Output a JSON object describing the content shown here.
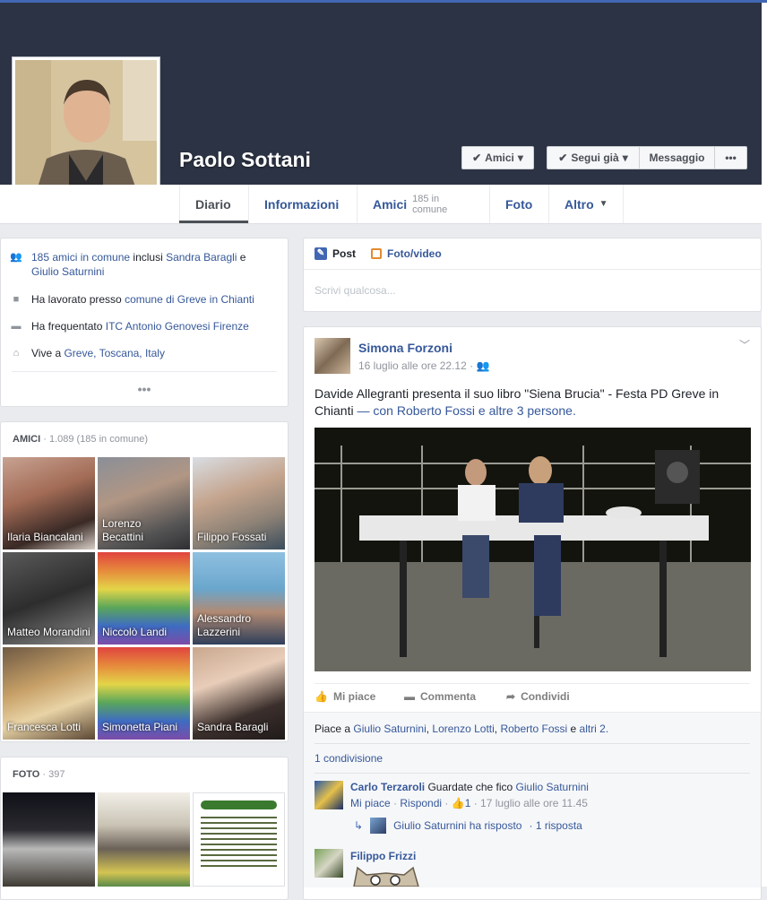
{
  "profile": {
    "name": "Paolo Sottani",
    "buttons": {
      "friends": "Amici",
      "follow": "Segui già",
      "message": "Messaggio",
      "more": "•••"
    }
  },
  "tabs": [
    {
      "label": "Diario",
      "extra": ""
    },
    {
      "label": "Informazioni",
      "extra": ""
    },
    {
      "label": "Amici",
      "extra": "185 in comune"
    },
    {
      "label": "Foto",
      "extra": ""
    },
    {
      "label": "Altro",
      "extra": ""
    }
  ],
  "intro": {
    "mutual": {
      "link": "185 amici in comune",
      "text1": " inclusi ",
      "name1": "Sandra Baragli",
      "text2": " e ",
      "name2": "Giulio Saturnini"
    },
    "work": {
      "prefix": "Ha lavorato presso ",
      "link": "comune di Greve in Chianti"
    },
    "school": {
      "prefix": "Ha frequentato ",
      "link": "ITC Antonio Genovesi Firenze"
    },
    "lives": {
      "prefix": "Vive a ",
      "link": "Greve, Toscana, Italy"
    },
    "more": "•••"
  },
  "friends_section": {
    "title": "AMICI",
    "count": " · 1.089 (185 in comune)",
    "friends": [
      "Ilaria Biancalani",
      "Lorenzo\nBecattini",
      "Filippo Fossati",
      "Matteo Morandini",
      "Niccolò Landi",
      "Alessandro\nLazzerini",
      "Francesca Lotti",
      "Simonetta Piani",
      "Sandra Baragli"
    ]
  },
  "photos_section": {
    "title": "FOTO",
    "count": " · 397"
  },
  "composer": {
    "tab_post": "Post",
    "tab_photo": "Foto/video",
    "placeholder": "Scrivi qualcosa..."
  },
  "post": {
    "author": "Simona Forzoni",
    "time": "16 luglio alle ore 22.12 ·",
    "text": "Davide Allegranti presenta il suo libro \"Siena Brucia\" - Festa PD Greve in Chianti",
    "with_prefix": " — con ",
    "with_name": "Roberto Fossi",
    "with_and": " e ",
    "with_others": "altre 3 persone.",
    "actions": {
      "like": "Mi piace",
      "comment": "Commenta",
      "share": "Condividi"
    },
    "likes": {
      "prefix": "Piace a ",
      "n1": "Giulio Saturnini",
      "c1": ", ",
      "n2": "Lorenzo Lotti",
      "c2": ", ",
      "n3": "Roberto Fossi",
      "c3": " e ",
      "others": "altri 2."
    },
    "shares": "1 condivisione",
    "comments": [
      {
        "author": "Carlo Terzaroli",
        "text": " Guardate che fico ",
        "mention": "Giulio Saturnini",
        "like": "Mi piace",
        "reply": "Rispondi",
        "like_count": "1",
        "time": "17 luglio alle ore 11.45",
        "reply_summary": "Giulio Saturnini ha risposto",
        "reply_count": "· 1 risposta"
      },
      {
        "author": "Filippo Frizzi"
      }
    ]
  }
}
